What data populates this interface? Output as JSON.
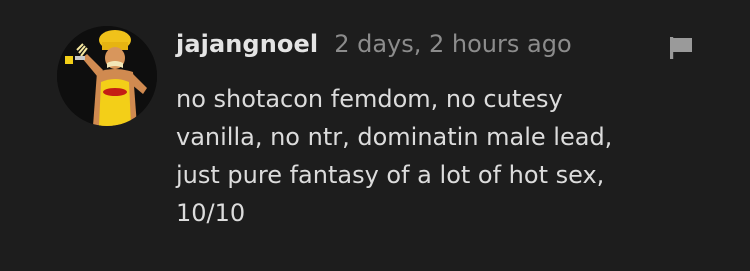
{
  "comment": {
    "username": "jajangnoel",
    "timestamp": "2 days, 2 hours ago",
    "text": "no shotacon femdom, no cutesy\nvanilla, no ntr, dominatin male lead,\njust pure fantasy of a lot of hot sex,\n10/10",
    "avatar_icon": "user-avatar",
    "flag_icon": "flag-icon"
  },
  "colors": {
    "background": "#1d1d1d",
    "username": "#e4e4e4",
    "timestamp": "#8c8c8c",
    "text": "#dcdcdc",
    "flag": "#9a9a9a"
  }
}
